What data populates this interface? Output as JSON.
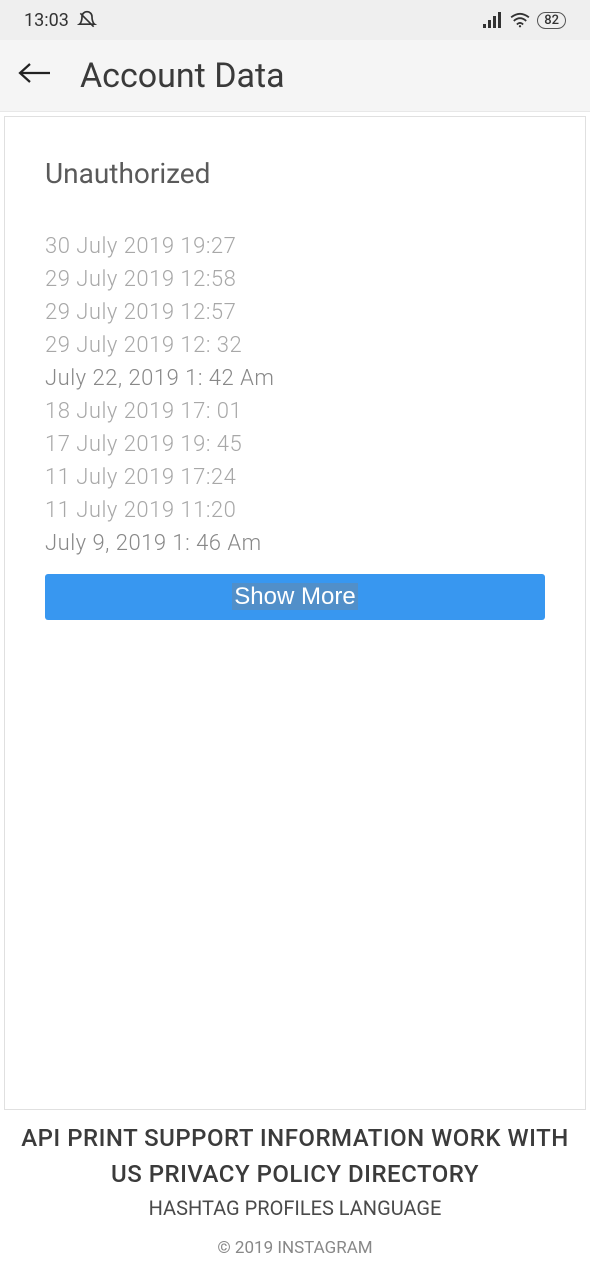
{
  "status": {
    "time": "13:03",
    "battery": "82"
  },
  "header": {
    "title": "Account Data"
  },
  "section": {
    "title": "Unauthorized"
  },
  "dates": [
    {
      "text": "30 July 2019 19:27",
      "style": "large"
    },
    {
      "text": "29 July 2019 12:58",
      "style": "large"
    },
    {
      "text": "29 July 2019 12:57",
      "style": "large"
    },
    {
      "text": "29 July 2019 12: 32",
      "style": "large"
    },
    {
      "text": "July 22, 2019 1: 42 Am",
      "style": "small"
    },
    {
      "text": "18 July 2019 17: 01",
      "style": "large"
    },
    {
      "text": "17 July 2019 19: 45",
      "style": "large"
    },
    {
      "text": "11 July 2019 17:24",
      "style": "large"
    },
    {
      "text": "11 July 2019 11:20",
      "style": "large"
    },
    {
      "text": "July 9, 2019 1: 46 Am",
      "style": "small"
    }
  ],
  "buttons": {
    "show_more": "Show More"
  },
  "footer": {
    "line1": "API PRINT SUPPORT INFORMATION WORK WITH US PRIVACY POLICY DIRECTORY",
    "line2": "HASHTAG PROFILES LANGUAGE",
    "copyright": "© 2019 INSTAGRAM"
  }
}
